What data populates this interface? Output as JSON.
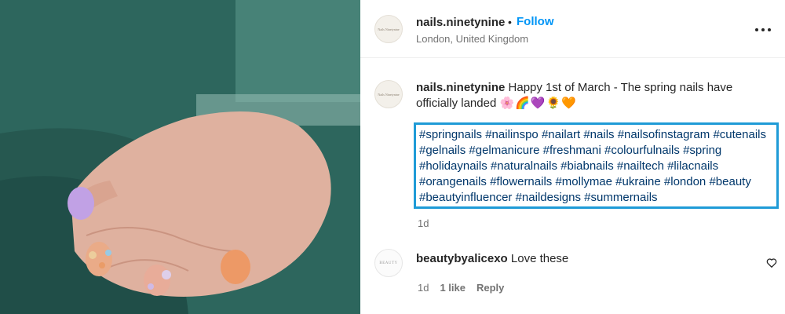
{
  "post": {
    "username": "nails.ninetynine",
    "separator": "•",
    "follow_label": "Follow",
    "location": "London, United Kingdom",
    "avatar_text": "Nails Ninetynine",
    "caption_text": "Happy 1st of March - The spring nails have officially landed",
    "caption_emojis": "🌸🌈💜🌻🧡",
    "hashtags": [
      "#springnails",
      "#nailinspo",
      "#nailart",
      "#nails",
      "#nailsofinstagram",
      "#cutenails",
      "#gelnails",
      "#gelmanicure",
      "#freshmani",
      "#colourfulnails",
      "#spring",
      "#holidaynails",
      "#naturalnails",
      "#biabnails",
      "#nailtech",
      "#lilacnails",
      "#orangenails",
      "#flowernails",
      "#mollymae",
      "#ukraine",
      "#london",
      "#beauty",
      "#beautyinfluencer",
      "#naildesigns",
      "#summernails"
    ],
    "age": "1d",
    "highlight_color": "#1f9bd7"
  },
  "comment": {
    "username": "beautybyalicexo",
    "text": "Love these",
    "avatar_text": "BEAUTY",
    "age": "1d",
    "likes": "1 like",
    "reply_label": "Reply"
  },
  "icons": {
    "more": "more-horizontal-icon",
    "heart": "heart-outline-icon"
  }
}
